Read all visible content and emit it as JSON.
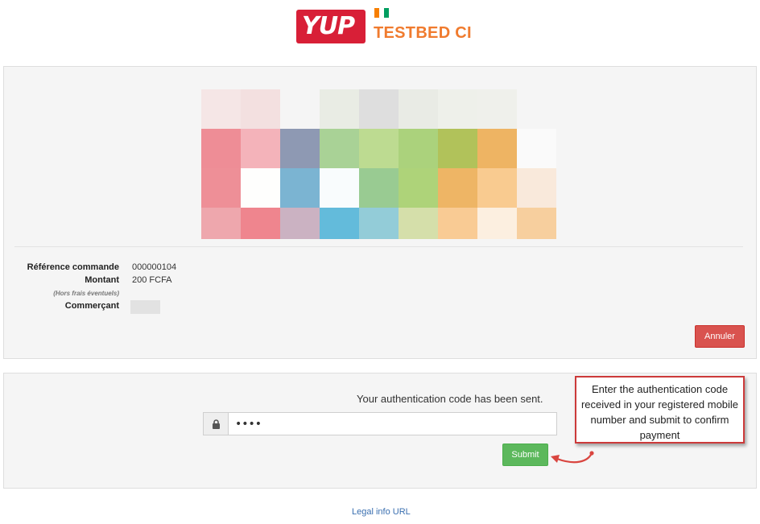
{
  "header": {
    "logo_text": "YUP",
    "brand": "TESTBED CI",
    "flag_colors": [
      "#f77f00",
      "#ffffff",
      "#009e60"
    ]
  },
  "qr_colors": [
    "#f5e6e6",
    "#f3e0e0",
    "#f5f5f5",
    "#e9ece4",
    "#dedede",
    "#e9ebe5",
    "#eef0ea",
    "#eff0eb",
    "#f5f5f5",
    "#ee8d96",
    "#f4b3ba",
    "#8e99b3",
    "#a9d296",
    "#bddb91",
    "#abd27c",
    "#b1c25a",
    "#eeb463",
    "#fafafa",
    "#ee8f97",
    "#fefefd",
    "#7bb4d2",
    "#f9fcfd",
    "#99cb92",
    "#aed379",
    "#eeb565",
    "#f9cb90",
    "#f9e9db",
    "#eea7ad",
    "#ef858e",
    "#cbb2c2",
    "#63bbdb",
    "#93ccd8",
    "#d5dfaa",
    "#f9cb94",
    "#fcefe0",
    "#f7cf9e"
  ],
  "order": {
    "reference_label": "Référence commande",
    "reference_value": "000000104",
    "amount_label": "Montant",
    "amount_value": "200 FCFA",
    "fees_note": "(Hors frais éventuels)",
    "merchant_label": "Commerçant"
  },
  "buttons": {
    "cancel": "Annuler",
    "submit": "Submit"
  },
  "auth": {
    "message": "Your authentication code has been sent.",
    "code_value": "••••",
    "lock_icon": "lock-icon"
  },
  "callout": "Enter the authentication code received in your registered mobile number and submit to confirm payment",
  "footer": {
    "legal_link": "Legal info URL"
  },
  "colors": {
    "brand_red": "#d81f37",
    "brand_orange": "#f07b2e",
    "cancel": "#d9534f",
    "submit": "#5cb85c",
    "callout_border": "#cc3a3a",
    "link": "#3a6fb0"
  }
}
